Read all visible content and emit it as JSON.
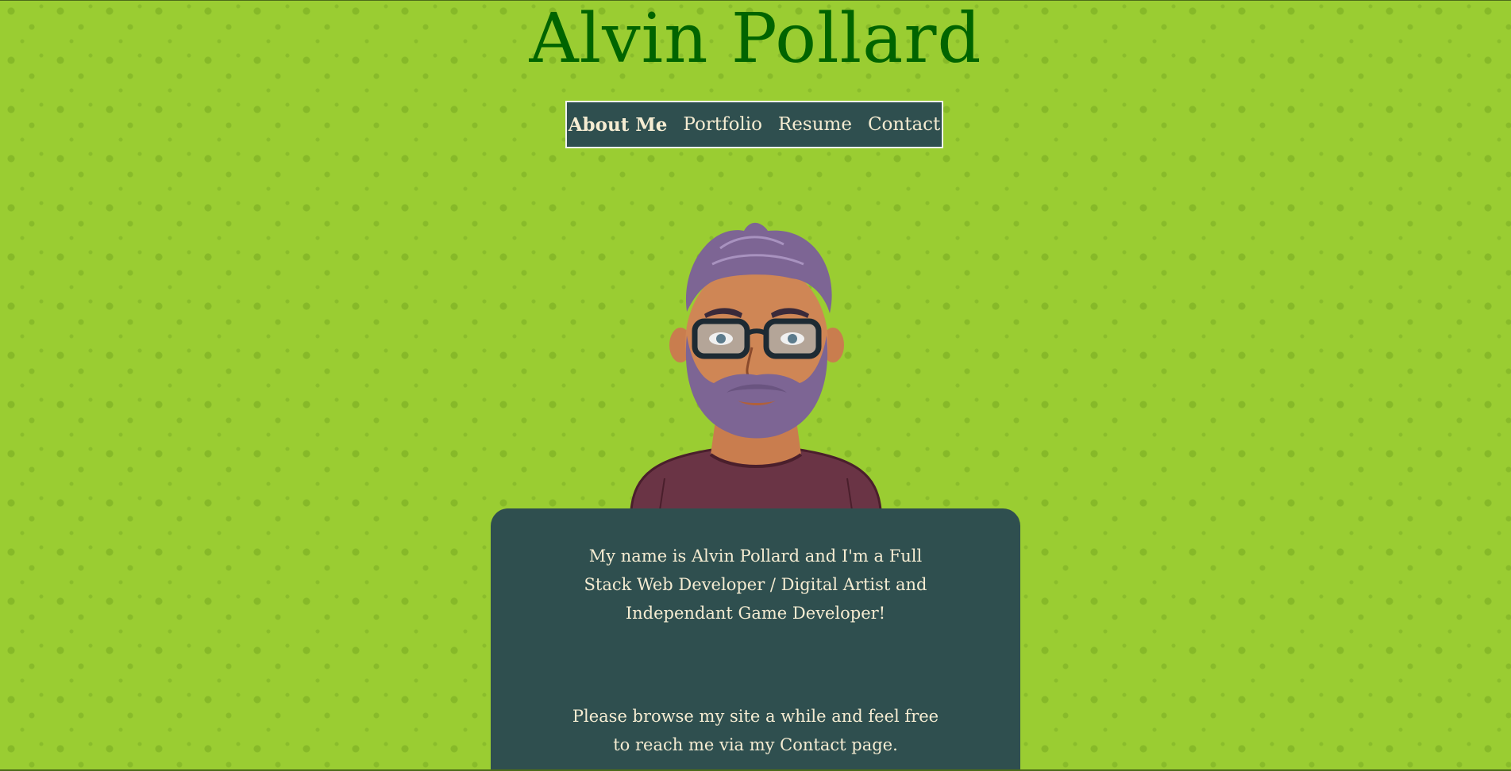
{
  "header": {
    "title": "Alvin Pollard"
  },
  "nav": {
    "items": [
      {
        "label": "About Me",
        "active": true
      },
      {
        "label": "Portfolio",
        "active": false
      },
      {
        "label": "Resume",
        "active": false
      },
      {
        "label": "Contact",
        "active": false
      }
    ]
  },
  "avatar": {
    "icon": "bearded-man-with-glasses-avatar"
  },
  "about": {
    "intro": "My name is Alvin Pollard and I'm a Full Stack Web Developer / Digital Artist and Independant Game Developer!",
    "browse": "Please browse my site a while and feel free to reach me via my Contact page."
  },
  "colors": {
    "background": "#9acd32",
    "title": "#006400",
    "panel": "#2f4f4f",
    "panel_text": "#f5ecd2"
  }
}
